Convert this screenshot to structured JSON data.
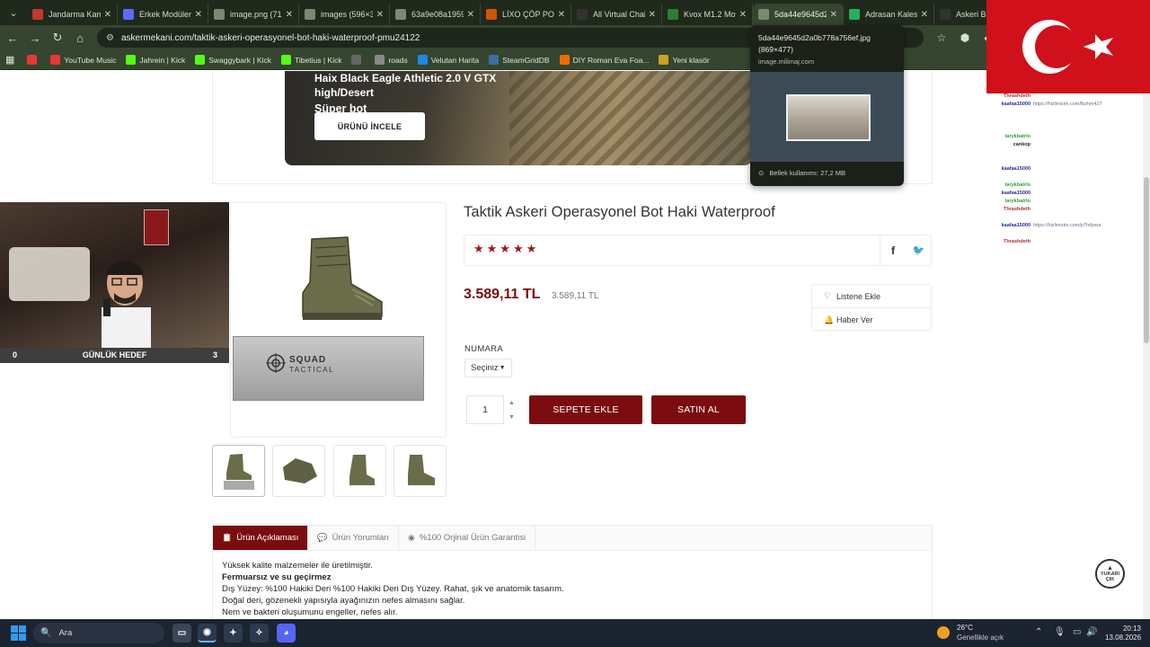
{
  "browser": {
    "tabs": [
      {
        "title": "Jandarma Kam",
        "color": "#c0392b"
      },
      {
        "title": "Erkek Modüler",
        "color": "#5b6cff"
      },
      {
        "title": "image.png (71",
        "color": "#7a8a70"
      },
      {
        "title": "images (596×3",
        "color": "#7a8a70"
      },
      {
        "title": "63a9e08a1959",
        "color": "#7a8a70"
      },
      {
        "title": "LİXO ÇÖP POŞ",
        "color": "#d35400"
      },
      {
        "title": "All Virtual Chal",
        "color": "#333333"
      },
      {
        "title": "Kvox M1.2 Mot",
        "color": "#2e7d32"
      },
      {
        "title": "5da44e9645d2",
        "color": "#7a8a70"
      },
      {
        "title": "Adrasan Kales",
        "color": "#27ae60"
      },
      {
        "title": "Askeri Bot |",
        "color": "#333333"
      }
    ],
    "active_tab_index": 8,
    "url": "askermekani.com/taktik-askeri-operasyonel-bot-haki-waterproof-pmu24122",
    "bookmarks": [
      {
        "label": "",
        "color": "#e53935"
      },
      {
        "label": "YouTube Music",
        "color": "#e53935"
      },
      {
        "label": "Jahrein | Kick",
        "color": "#53fc18"
      },
      {
        "label": "Swaggybark | Kick",
        "color": "#53fc18"
      },
      {
        "label": "Tibetius | Kick",
        "color": "#53fc18"
      },
      {
        "label": "",
        "color": "#666666"
      },
      {
        "label": "roads",
        "color": "#888888"
      },
      {
        "label": "Velutan Harita",
        "color": "#1e88e5"
      },
      {
        "label": "SteamGridDB",
        "color": "#3b6ea5"
      },
      {
        "label": "DIY Roman Eva Foa...",
        "color": "#ef6c00"
      },
      {
        "label": "Yeni klasör",
        "color": "#c9a227"
      }
    ]
  },
  "tooltip": {
    "title": "5da44e9645d2a0b778a756ef.jpg",
    "dimensions": "(869×477)",
    "domain": "image.milimaj.com",
    "memory": "Bellek kullanımı: 27,2 MB"
  },
  "banner": {
    "title_line1": "Haix Black Eagle Athletic 2.0 V GTX high/Desert",
    "title_line2": "Süper bot",
    "button": "ÜRÜNÜ İNCELE"
  },
  "product": {
    "title": "Taktik Askeri Operasyonel Bot Haki Waterproof",
    "stars": "★★★★★",
    "rating": 5,
    "price": "3.589,11 TL",
    "old_price": "3.589,11 TL",
    "wishlist": "Listene Ekle",
    "notify": "Haber Ver",
    "size_label": "NUMARA",
    "size_value": "Seçiniz",
    "quantity": "1",
    "add_to_cart": "SEPETE EKLE",
    "buy_now": "SATIN AL",
    "box_brand_line1": "SQUAD",
    "box_brand_line2": "TACTICAL"
  },
  "product_tabs": [
    {
      "label": "Ürün Açıklaması",
      "icon": "📋"
    },
    {
      "label": "Ürün Yorumları",
      "icon": "💬"
    },
    {
      "label": "%100 Orjinal Ürün Garantisi",
      "icon": "◉"
    }
  ],
  "description": [
    {
      "text": "Yüksek kalite malzemeler ile üretilmiştir.",
      "bold": false
    },
    {
      "text": "Fermuarsız ve su geçirmez",
      "bold": true
    },
    {
      "text": "Dış Yüzey: %100 Hakiki Deri %100 Hakiki Deri Dış Yüzey. Rahat, şık ve anatomik tasarım.",
      "bold": false
    },
    {
      "text": "Doğal deri, gözenekli yapısıyla ayağınızın nefes almasını sağlar.",
      "bold": false
    },
    {
      "text": "Nem ve bakteri oluşumunu engeller, nefes alır.",
      "bold": false
    }
  ],
  "scroll_top": {
    "line1": "YUKARI",
    "line2": "ÇIK"
  },
  "stream": {
    "goal_left": "0",
    "goal_label": "GÜNLÜK HEDEF",
    "goal_right": "3",
    "chat": [
      {
        "user": "Thrashdeth",
        "color": "#b03030",
        "msg": ""
      },
      {
        "user": "kaafaa15000",
        "color": "#2a2aa0",
        "msg": "https://hizliresim.com/lbzhm427"
      },
      {
        "user": "",
        "color": "#2a2aa0",
        "msg": ""
      },
      {
        "user": "",
        "color": "#2a2aa0",
        "msg": ""
      },
      {
        "user": "",
        "color": "#2a2aa0",
        "msg": ""
      },
      {
        "user": "tarykbatrlo",
        "color": "#2f9e3a",
        "msg": ""
      },
      {
        "user": "cankop",
        "color": "#222222",
        "msg": ""
      },
      {
        "user": "",
        "color": "#222222",
        "msg": ""
      },
      {
        "user": "",
        "color": "#222222",
        "msg": ""
      },
      {
        "user": "kaafaa15000",
        "color": "#2a2aa0",
        "msg": ""
      },
      {
        "user": "",
        "color": "#2a2aa0",
        "msg": ""
      },
      {
        "user": "tarykbatrlo",
        "color": "#2f9e3a",
        "msg": ""
      },
      {
        "user": "kaafaa15000",
        "color": "#2a2aa0",
        "msg": ""
      },
      {
        "user": "tarykbatrlo",
        "color": "#2f9e3a",
        "msg": ""
      },
      {
        "user": "Thrashdeth",
        "color": "#b03030",
        "msg": ""
      },
      {
        "user": "",
        "color": "#b03030",
        "msg": ""
      },
      {
        "user": "kaafaa15000",
        "color": "#2a2aa0",
        "msg": "https://hizliresim.com/p7hdyeur"
      },
      {
        "user": "",
        "color": "#2a2aa0",
        "msg": ""
      },
      {
        "user": "Thrashdeth",
        "color": "#b03030",
        "msg": ""
      }
    ]
  },
  "taskbar": {
    "search_placeholder": "Ara",
    "temperature": "26°C",
    "weather": "Genellikle açık",
    "time": "20:13",
    "date": "13.08.2026"
  }
}
